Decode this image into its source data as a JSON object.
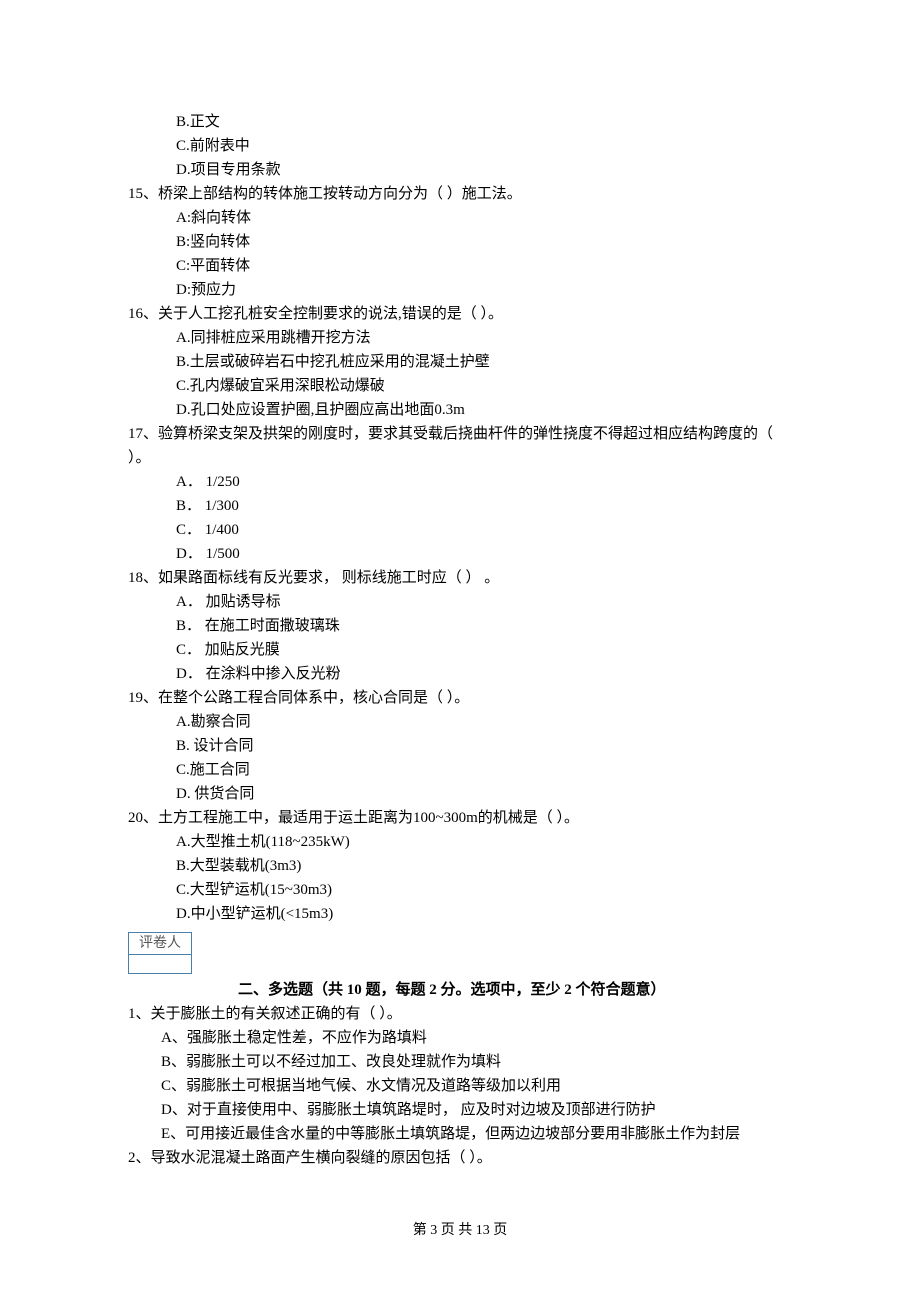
{
  "partials": {
    "opt_b": "B.正文",
    "opt_c": "C.前附表中",
    "opt_d": "D.项目专用条款"
  },
  "q15": {
    "stem": "15、桥梁上部结构的转体施工按转动方向分为（   ）施工法。",
    "a": "A:斜向转体",
    "b": "B:竖向转体",
    "c": "C:平面转体",
    "d": "D:预应力"
  },
  "q16": {
    "stem": "16、关于人工挖孔桩安全控制要求的说法,错误的是（    ）。",
    "a": "A.同排桩应采用跳槽开挖方法",
    "b": "B.土层或破碎岩石中挖孔桩应采用的混凝土护壁",
    "c": "C.孔内爆破宜采用深眼松动爆破",
    "d": "D.孔口处应设置护圈,且护圈应高出地面0.3m"
  },
  "q17": {
    "stem": "17、验算桥梁支架及拱架的刚度时，要求其受载后挠曲杆件的弹性挠度不得超过相应结构跨度的（     ）。",
    "a": "A． 1/250",
    "b": "B． 1/300",
    "c": "C． 1/400",
    "d": "D． 1/500"
  },
  "q18": {
    "stem": "18、如果路面标线有反光要求， 则标线施工时应（     ） 。",
    "a": "A． 加贴诱导标",
    "b": "B． 在施工时面撒玻璃珠",
    "c": "C． 加贴反光膜",
    "d": "D． 在涂料中掺入反光粉"
  },
  "q19": {
    "stem": "19、在整个公路工程合同体系中，核心合同是（     ）。",
    "a": "A.勘察合同",
    "b": "B. 设计合同",
    "c": "C.施工合同",
    "d": "D. 供货合同"
  },
  "q20": {
    "stem": "20、土方工程施工中，最适用于运土距离为100~300m的机械是（     ）。",
    "a": "A.大型推土机(118~235kW)",
    "b": "B.大型装载机(3m3)",
    "c": "C.大型铲运机(15~30m3)",
    "d": "D.中小型铲运机(<15m3)"
  },
  "grader_label": "评卷人",
  "section2_title": "二、多选题（共 10 题，每题 2 分。选项中，至少 2 个符合题意）",
  "s2q1": {
    "stem": "1、关于膨胀土的有关叙述正确的有（     ）。",
    "a": "A、强膨胀土稳定性差，不应作为路填料",
    "b": "B、弱膨胀土可以不经过加工、改良处理就作为填料",
    "c": "C、弱膨胀土可根据当地气候、水文情况及道路等级加以利用",
    "d": "D、对于直接使用中、弱膨胀土填筑路堤时， 应及时对边坡及顶部进行防护",
    "e": "E、可用接近最佳含水量的中等膨胀土填筑路堤，但两边边坡部分要用非膨胀土作为封层"
  },
  "s2q2": {
    "stem": "2、导致水泥混凝土路面产生横向裂缝的原因包括（     ）。"
  },
  "footer": "第 3 页 共 13 页"
}
